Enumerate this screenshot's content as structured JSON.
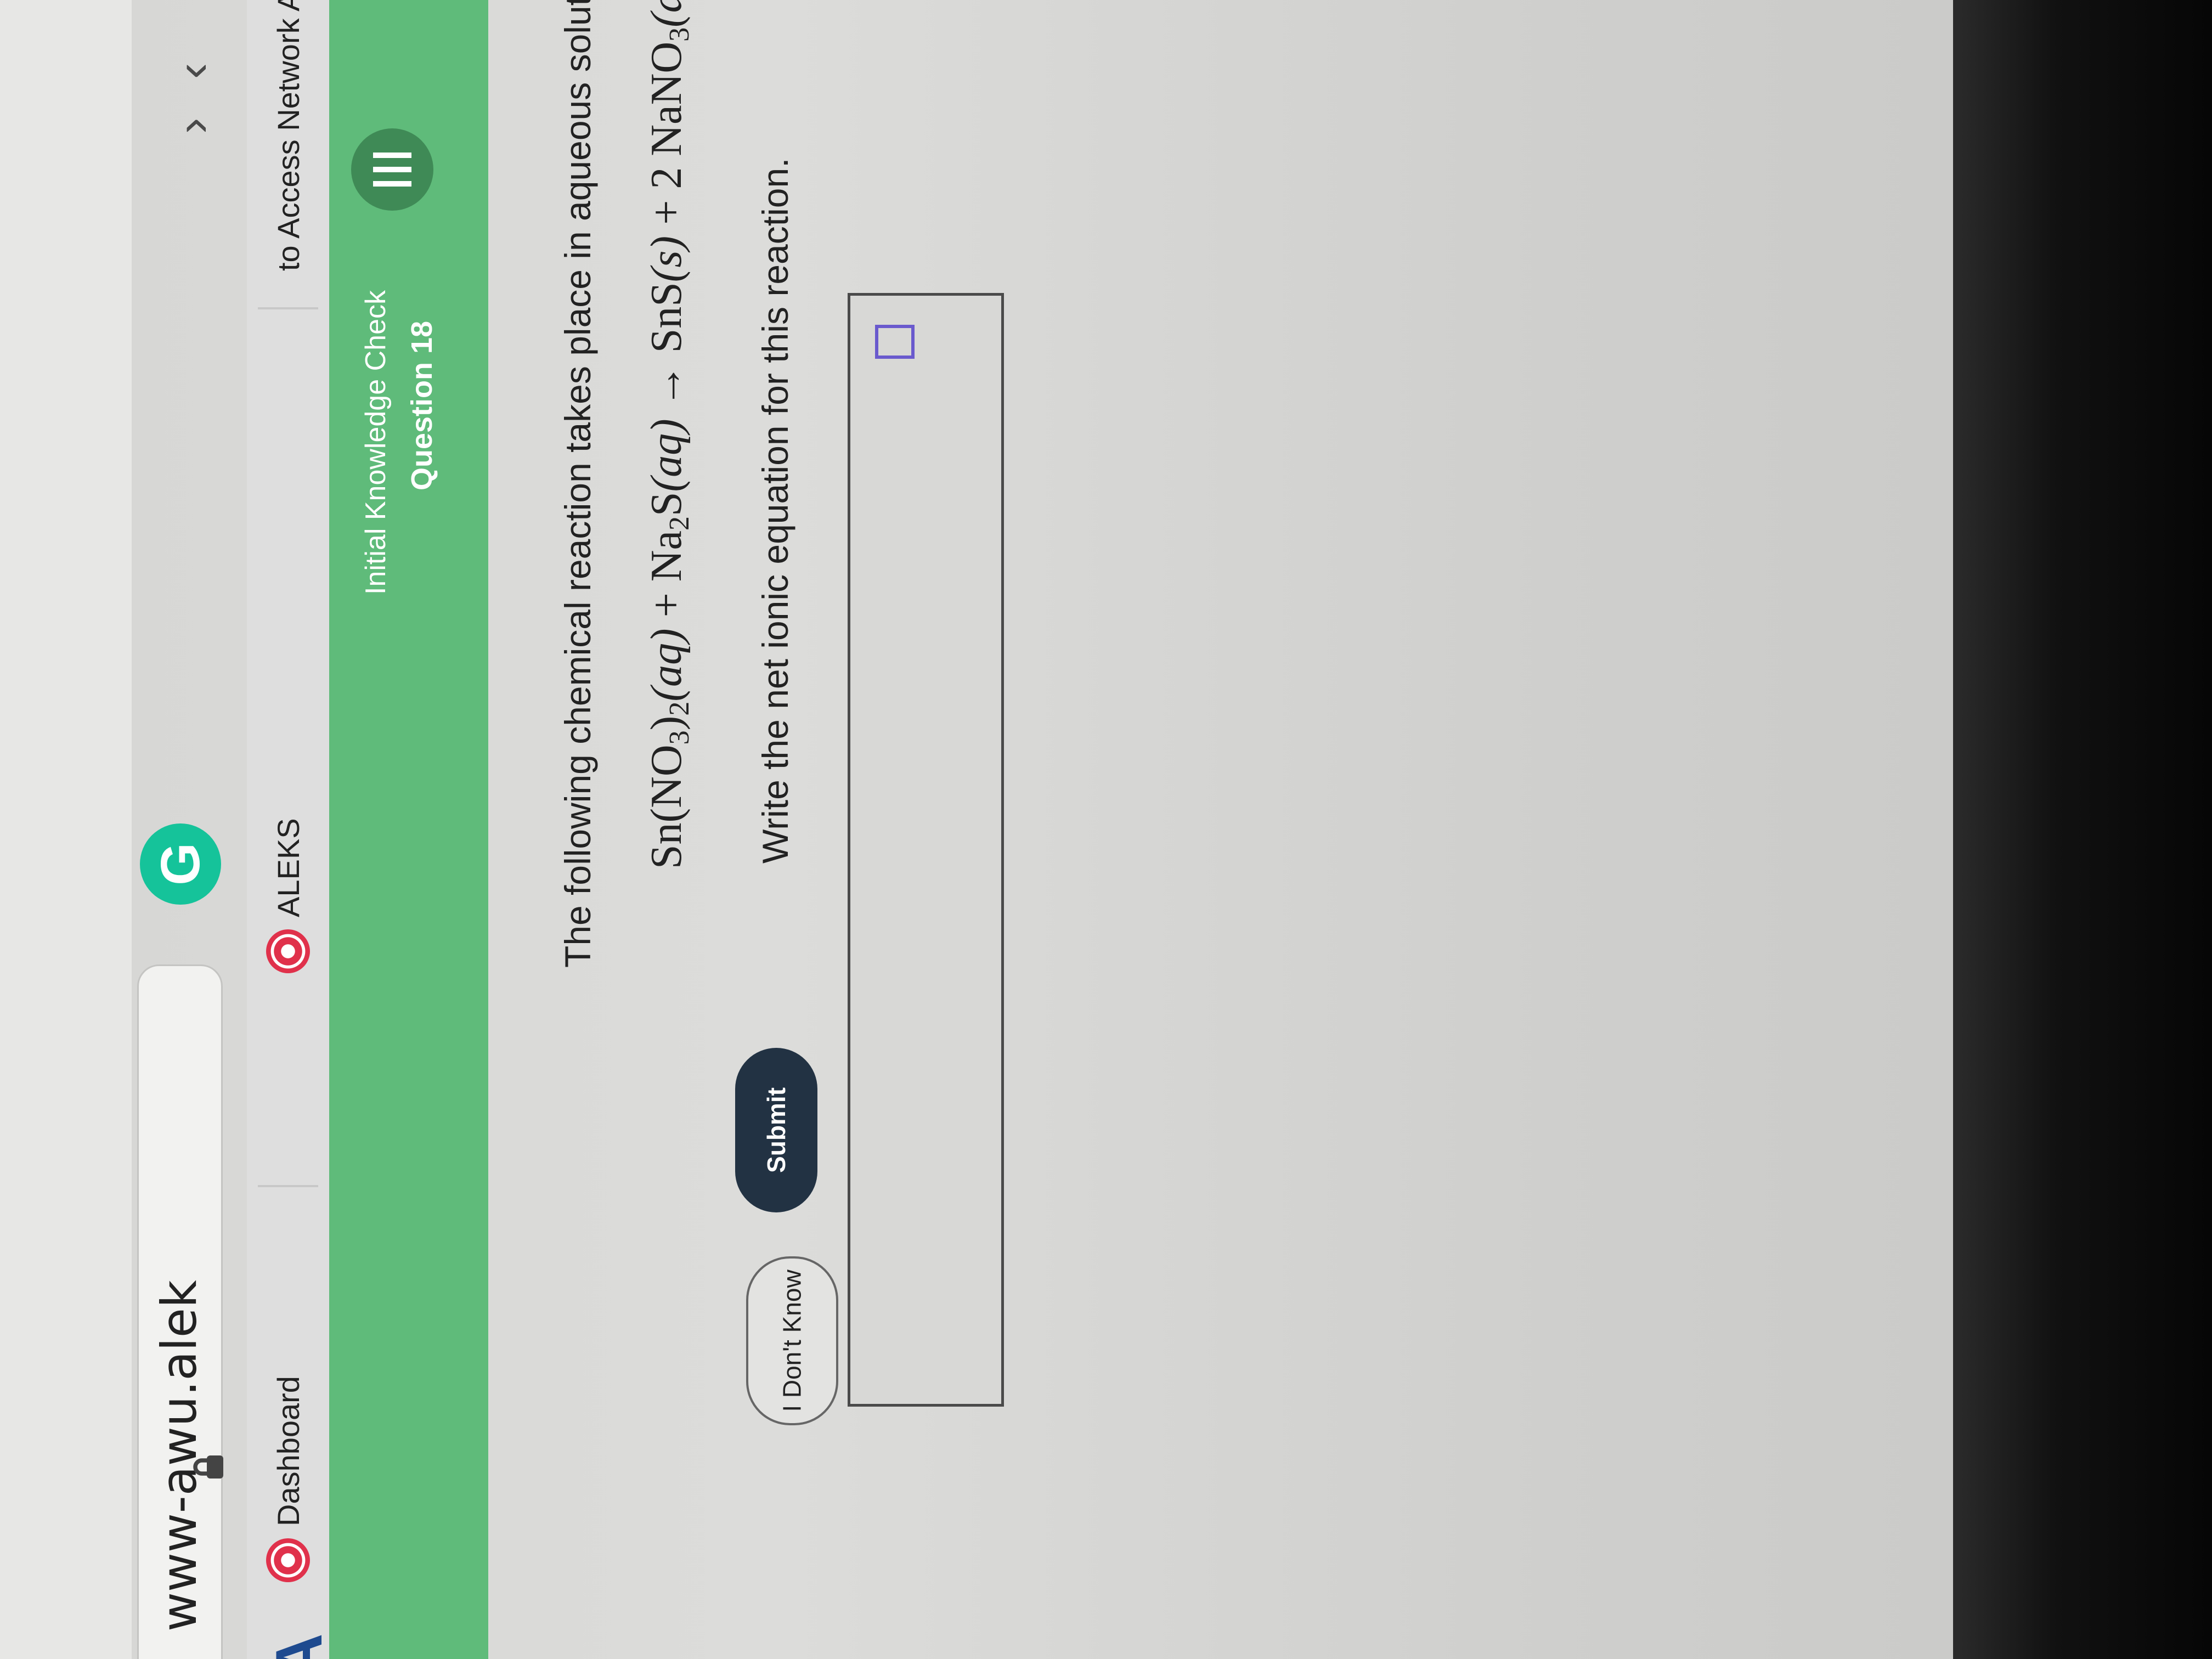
{
  "browser": {
    "url": "www-awu.alek",
    "back_icon": "chevron-left-icon",
    "forward_icon": "chevron-right-icon"
  },
  "tabs": [
    {
      "label": "to Access Network Applica..."
    },
    {
      "label": "ALEKS"
    },
    {
      "label": "Dashboard"
    },
    {
      "label": "A"
    }
  ],
  "header": {
    "title": "Initial Knowledge Check",
    "subtitle": "Question 18"
  },
  "question": {
    "intro": "The following chemical reaction takes place in aqueous solution:",
    "prompt": "Write the net ionic equation for this reaction."
  },
  "equation": {
    "reactant1": "Sn(NO",
    "reactant1_sub": "3",
    "reactant1_close": ")",
    "reactant1_sub2": "2",
    "reactant1_state": "(aq)",
    "plus1": "+",
    "reactant2": "Na",
    "reactant2_sub": "2",
    "reactant2_tail": "S",
    "reactant2_state": "(aq)",
    "arrow": "→",
    "product1": "SnS",
    "product1_state": "(s)",
    "plus2": "+",
    "product2_coef": "2",
    "product2": "NaNO",
    "product2_sub": "3",
    "product2_state": "(aq)"
  },
  "buttons": {
    "dont_know": "I Don't Know",
    "submit": "Submit"
  },
  "colors": {
    "header_green": "#5fbb7a",
    "submit_bg": "#223243",
    "grammarly": "#15c39a"
  }
}
